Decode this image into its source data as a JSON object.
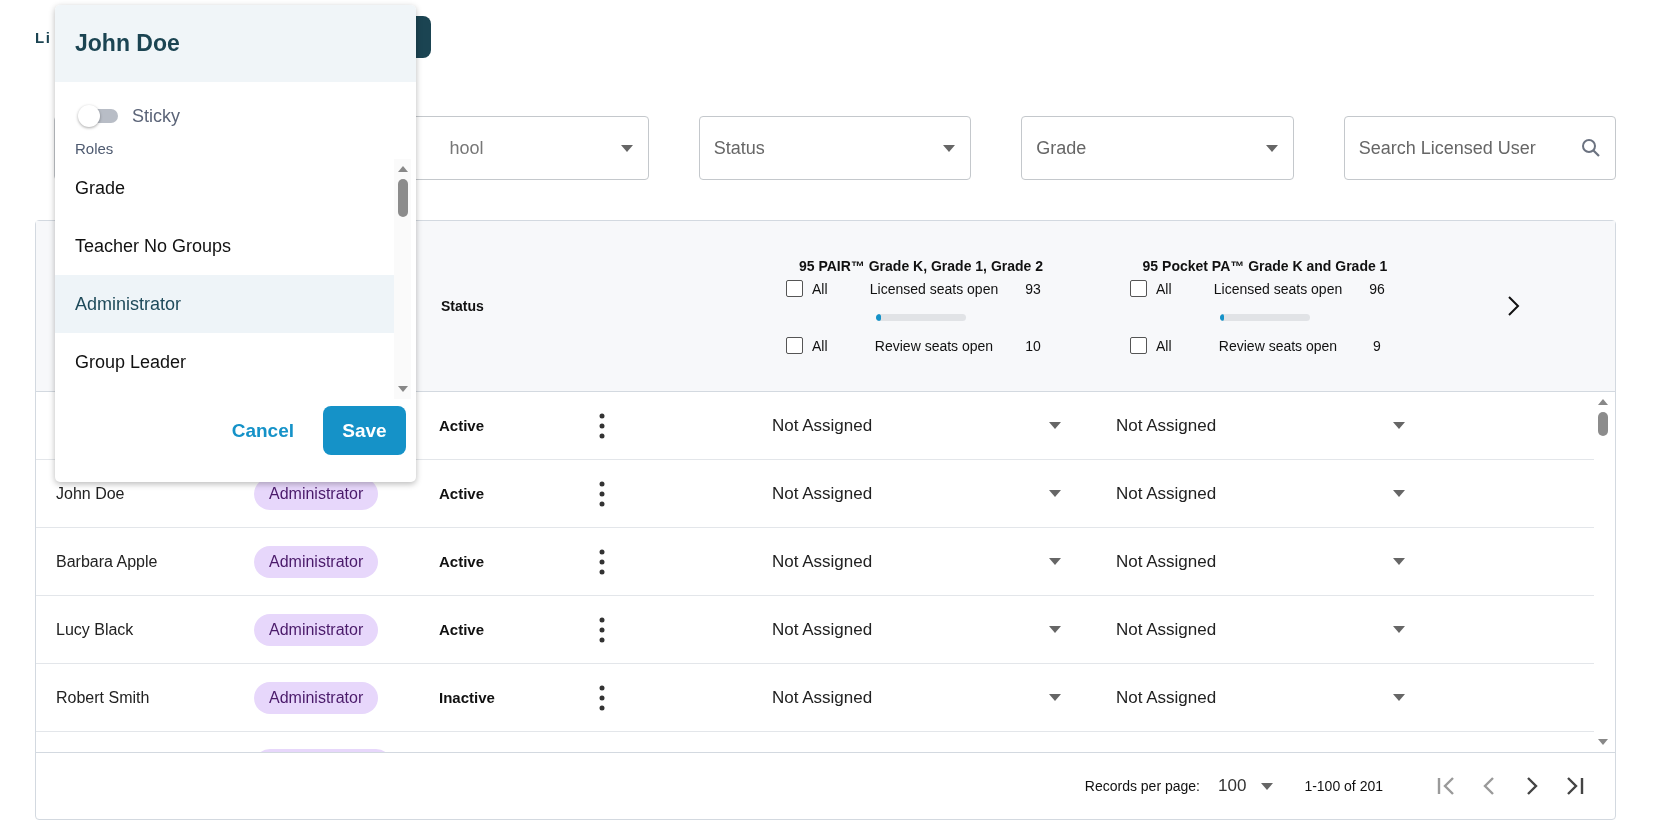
{
  "page_title": "Li",
  "filters": [
    {
      "kind": "covered"
    },
    {
      "kind": "select",
      "value": "hool"
    },
    {
      "kind": "select",
      "placeholder": "Status"
    },
    {
      "kind": "select",
      "placeholder": "Grade"
    },
    {
      "kind": "search",
      "placeholder": "Search Licensed User"
    }
  ],
  "table": {
    "status_heading": "Status",
    "products": [
      {
        "title": "95 PAIR™ Grade K, Grade 1, Grade 2",
        "licensed": {
          "all_label": "All",
          "checked": false,
          "label": "Licensed seats open",
          "count": "93"
        },
        "level": 0.05,
        "review": {
          "all_label": "All",
          "checked": false,
          "label": "Review seats open",
          "count": "10"
        }
      },
      {
        "title": "95 Pocket PA™ Grade K and Grade 1",
        "licensed": {
          "all_label": "All",
          "checked": false,
          "label": "Licensed seats open",
          "count": "96"
        },
        "level": 0.04,
        "review": {
          "all_label": "All",
          "checked": false,
          "label": "Review seats open",
          "count": "9"
        }
      }
    ],
    "rows": [
      {
        "kind": "full",
        "status": "Active",
        "assignments": [
          "Not Assigned",
          "Not Assigned"
        ]
      },
      {
        "kind": "full",
        "name": "John Doe",
        "role": "Administrator",
        "status": "Active",
        "assignments": [
          "Not Assigned",
          "Not Assigned"
        ]
      },
      {
        "kind": "full",
        "name": "Barbara Apple",
        "role": "Administrator",
        "status": "Active",
        "assignments": [
          "Not Assigned",
          "Not Assigned"
        ]
      },
      {
        "kind": "full",
        "name": "Lucy Black",
        "role": "Administrator",
        "status": "Active",
        "assignments": [
          "Not Assigned",
          "Not Assigned"
        ]
      },
      {
        "kind": "full",
        "name": "Robert Smith",
        "role": "Administrator",
        "status": "Inactive",
        "assignments": [
          "Not Assigned",
          "Not Assigned"
        ]
      },
      {
        "kind": "partial"
      }
    ],
    "footer": {
      "records_label": "Records per page:",
      "per_page": "100",
      "range": "1-100 of 201",
      "pager": [
        {
          "kind": "first",
          "disabled": true
        },
        {
          "kind": "prev",
          "disabled": true
        },
        {
          "kind": "next",
          "disabled": false
        },
        {
          "kind": "last",
          "disabled": false
        }
      ]
    }
  },
  "popover": {
    "title": "John Doe",
    "sticky": {
      "label": "Sticky",
      "on": false
    },
    "roles_label": "Roles",
    "roles": [
      {
        "label": "Grade",
        "selected": false
      },
      {
        "label": "Teacher No Groups",
        "selected": false
      },
      {
        "label": "Administrator",
        "selected": true
      },
      {
        "label": "Group Leader",
        "selected": false
      }
    ],
    "cancel": "Cancel",
    "save": "Save"
  }
}
